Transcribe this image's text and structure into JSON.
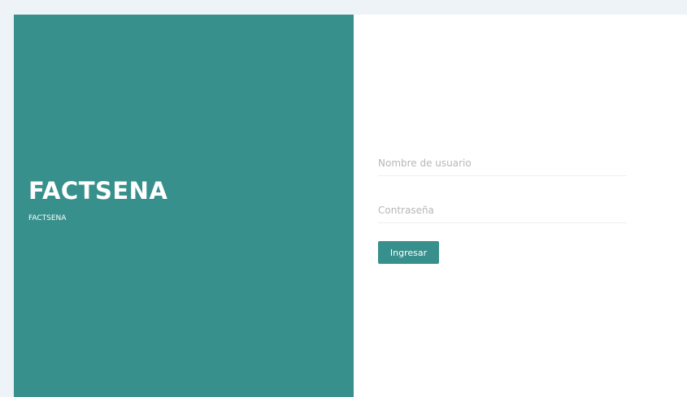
{
  "brand": {
    "title": "FACTSENA",
    "subtitle": "FACTSENA"
  },
  "login": {
    "username_placeholder": "Nombre de usuario",
    "password_placeholder": "Contraseña",
    "submit_label": "Ingresar"
  },
  "colors": {
    "accent": "#37908c",
    "page_background": "#eef3f8"
  }
}
